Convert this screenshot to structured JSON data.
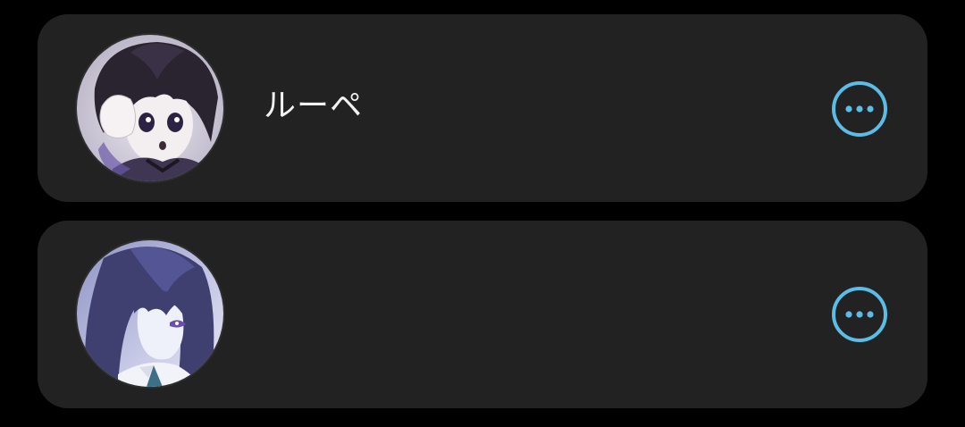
{
  "accent_color": "#5bbde6",
  "card_color": "#222222",
  "contacts": [
    {
      "name": "ルーペ",
      "more_icon": "more-horizontal-circle-icon",
      "avatar": "anime-portrait-dark-hair-purple-eyes"
    },
    {
      "name": "",
      "more_icon": "more-horizontal-circle-icon",
      "avatar": "anime-portrait-long-dark-hair-tie"
    }
  ]
}
